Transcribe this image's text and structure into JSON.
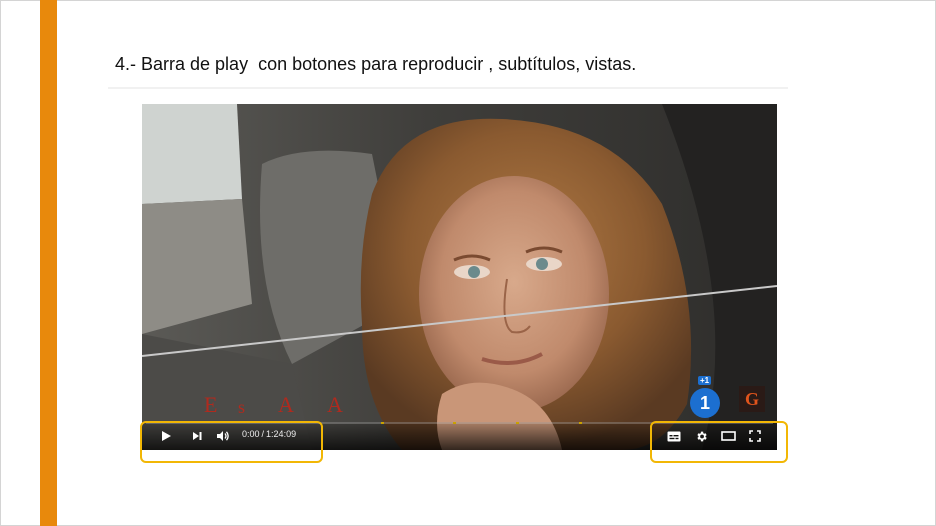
{
  "slide": {
    "title": "4.- Barra de play  con botones para reproducir , subtítulos, vistas.",
    "accent_color": "#e8890c",
    "highlight_color": "#f2b705"
  },
  "video": {
    "current_time": "0:00",
    "separator": "/",
    "duration": "1:24:09",
    "progress_fraction": 0,
    "channel_badge": "1",
    "channel_badge_plus": "+1",
    "watermark_letter": "G",
    "overlay_letters": [
      "E",
      "s",
      "A",
      "A"
    ],
    "ad_marker_fractions": [
      0.375,
      0.49,
      0.59,
      0.69
    ]
  },
  "controls": {
    "left": [
      {
        "name": "play-button",
        "icon": "play-icon"
      },
      {
        "name": "next-button",
        "icon": "skip-next-icon"
      },
      {
        "name": "volume-button",
        "icon": "volume-icon"
      }
    ],
    "right": [
      {
        "name": "subtitles-button",
        "icon": "subtitles-icon"
      },
      {
        "name": "settings-button",
        "icon": "gear-icon"
      },
      {
        "name": "theater-mode-button",
        "icon": "theater-icon"
      },
      {
        "name": "fullscreen-button",
        "icon": "fullscreen-icon"
      }
    ]
  }
}
